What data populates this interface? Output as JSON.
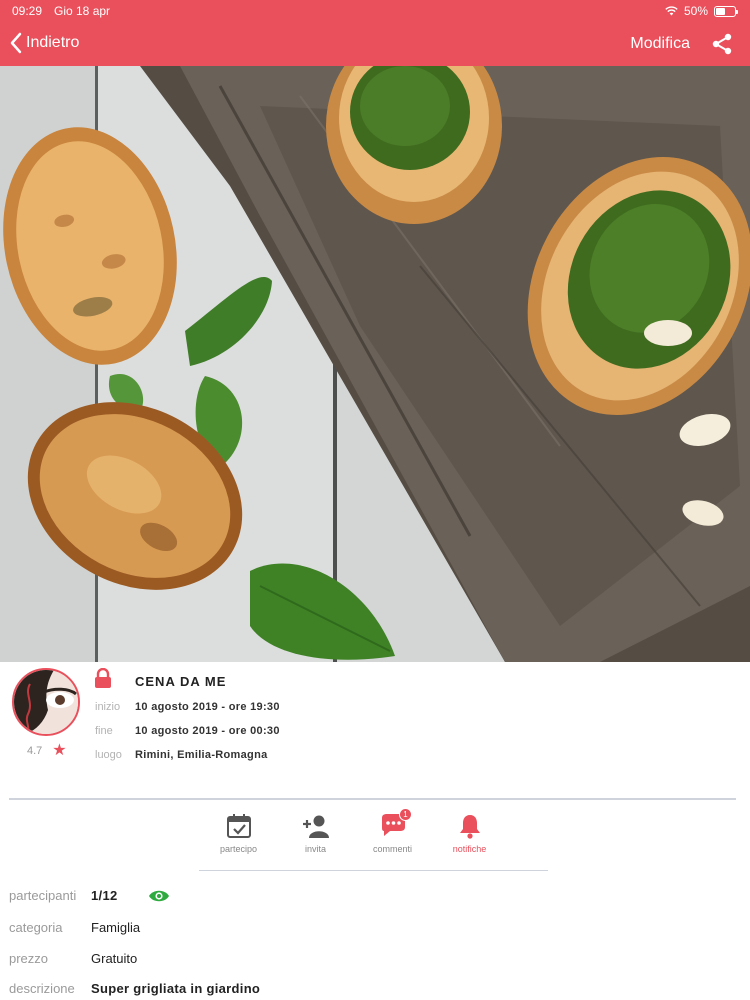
{
  "status_bar": {
    "time": "09:29",
    "date": "Gio 18 apr",
    "battery": "50%",
    "battery_level": 0.5
  },
  "nav": {
    "back_label": "Indietro",
    "edit_label": "Modifica"
  },
  "event": {
    "title": "CENA DA ME",
    "rating": "4.7",
    "rows": [
      {
        "key": "inizio",
        "value": "10 agosto 2019 - ore 19:30"
      },
      {
        "key": "fine",
        "value": "10 agosto 2019 - ore 00:30"
      },
      {
        "key": "luogo",
        "value": "Rimini, Emilia-Romagna"
      }
    ]
  },
  "actions": [
    {
      "label": "partecipo",
      "icon": "calendar-check-icon"
    },
    {
      "label": "invita",
      "icon": "add-user-icon"
    },
    {
      "label": "commenti",
      "icon": "comments-icon",
      "badge": "1"
    },
    {
      "label": "notifiche",
      "icon": "bell-icon",
      "active": true
    }
  ],
  "details": [
    {
      "key": "partecipanti",
      "value": "1/12"
    },
    {
      "key": "categoria",
      "value": "Famiglia"
    },
    {
      "key": "prezzo",
      "value": "Gratuito"
    },
    {
      "key": "descrizione",
      "value": "Super grigliata in giardino"
    }
  ],
  "colors": {
    "brand": "#e9505c",
    "visible": "#2eaa3f"
  }
}
